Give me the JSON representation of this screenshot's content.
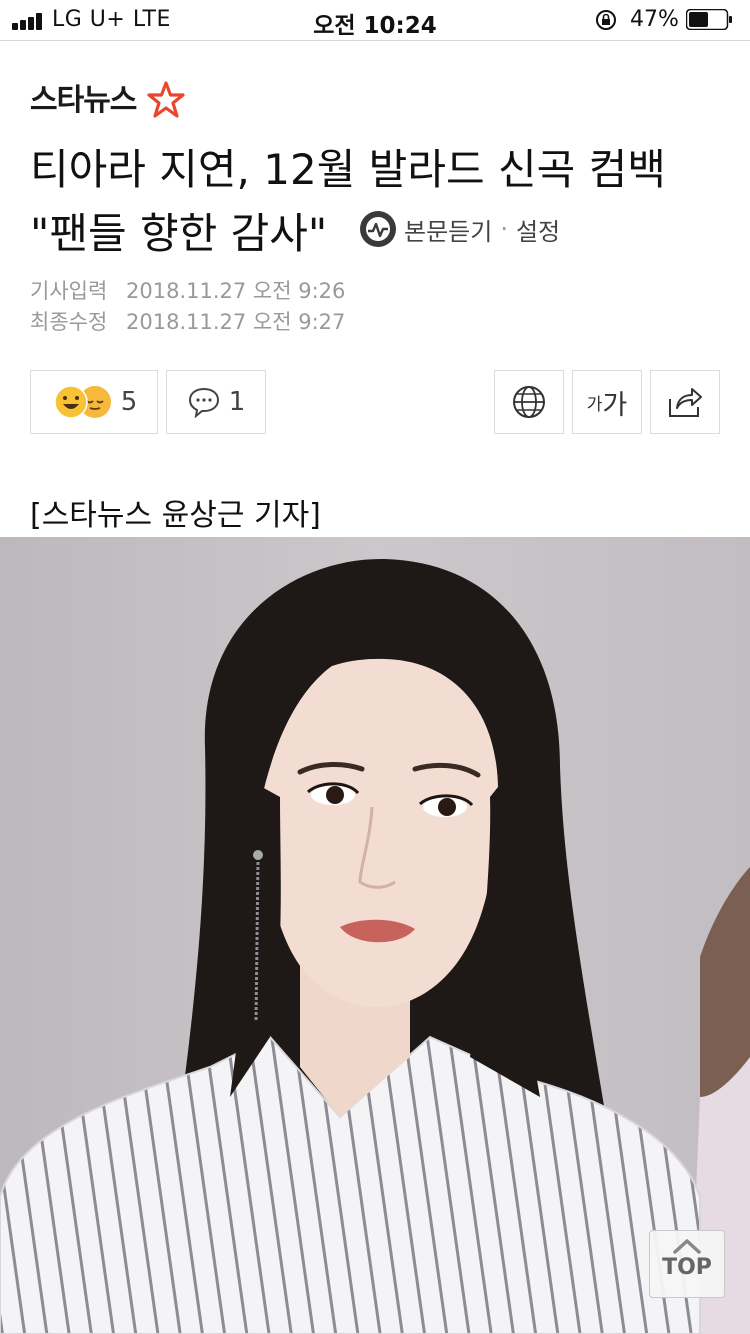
{
  "status_bar": {
    "carrier": "LG U+  LTE",
    "time": "오전 10:24",
    "battery": "47%"
  },
  "brand": {
    "name": "스타뉴스",
    "accent_color": "#e8472b"
  },
  "article": {
    "headline_line1": "티아라 지연, 12월 발라드 신곡 컴백",
    "headline_line2": "\"팬들 향한 감사\"",
    "listen_label": "본문듣기",
    "separator": "·",
    "settings_label": "설정",
    "published_label": "기사입력",
    "published_value": "2018.11.27 오전 9:26",
    "modified_label": "최종수정",
    "modified_value": "2018.11.27 오전 9:27",
    "byline": "[스타뉴스 윤상근 기자]"
  },
  "actions": {
    "reaction_count": "5",
    "comment_count": "1",
    "font_small": "가",
    "font_big": "가",
    "icons": [
      "emoji-reaction-icon",
      "comment-icon",
      "globe-icon",
      "font-size-icon",
      "share-icon"
    ]
  },
  "top_button": {
    "label": "TOP"
  }
}
